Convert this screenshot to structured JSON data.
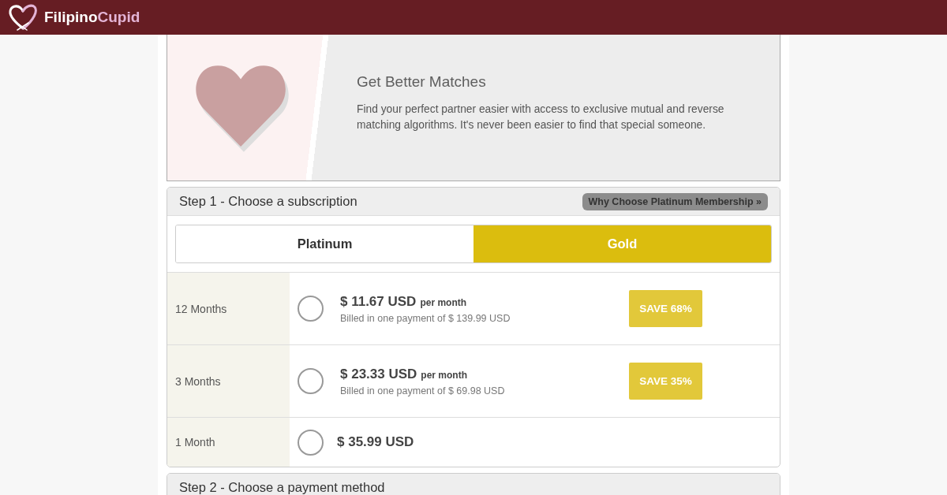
{
  "header": {
    "logo": {
      "text": "Filipino",
      "accent": "Cupid"
    }
  },
  "banner": {
    "title": "Get Better Matches",
    "text": "Find your perfect partner easier with access to exclusive mutual and reverse matching algorithms. It's never been easier to find that special someone."
  },
  "step_1": {
    "title": "Step 1 - Choose a subscription",
    "link": "Why Choose Platinum Membership »",
    "tiers": [
      {
        "label": "Platinum",
        "selected": false
      },
      {
        "label": "Gold",
        "selected": true
      }
    ],
    "plans": [
      {
        "duration": "12 Months",
        "selected": false,
        "price": "$ 11.67 USD",
        "unit": "per month",
        "billing": "Billed in one payment of $ 139.99 USD",
        "badge": "SAVE 68%"
      },
      {
        "duration": "3 Months",
        "selected": false,
        "price": "$ 23.33 USD",
        "unit": "per month",
        "billing": "Billed in one payment of $ 69.98 USD",
        "badge": "SAVE 35%"
      },
      {
        "duration": "1 Month",
        "selected": false,
        "price": "$ 35.99 USD"
      }
    ]
  },
  "step_2": {
    "title": "Step 2 - Choose a payment method"
  }
}
